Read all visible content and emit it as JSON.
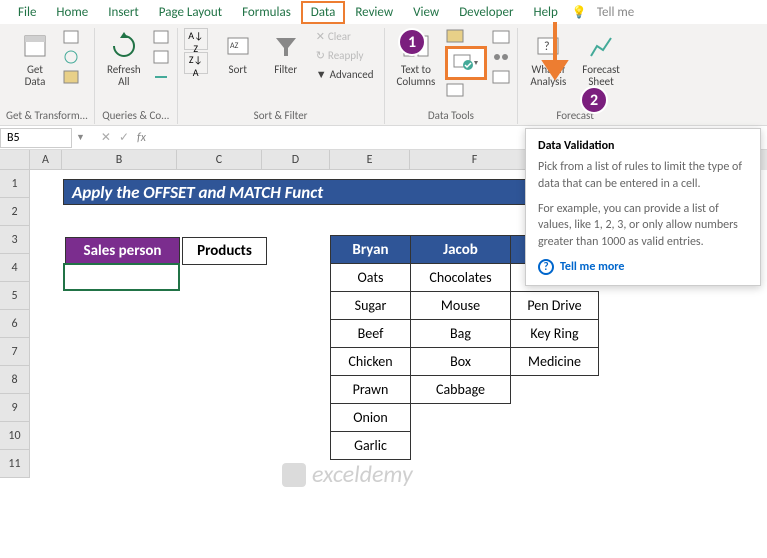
{
  "menu": {
    "items": [
      "File",
      "Home",
      "Insert",
      "Page Layout",
      "Formulas",
      "Data",
      "Review",
      "View",
      "Developer",
      "Help"
    ],
    "tellme": "Tell me"
  },
  "ribbon": {
    "getdata": "Get\nData",
    "refresh": "Refresh\nAll",
    "sort": "Sort",
    "filter": "Filter",
    "clear": "Clear",
    "reapply": "Reapply",
    "advanced": "Advanced",
    "t2c": "Text to\nColumns",
    "whatif": "What-If\nAnalysis",
    "forecast": "Forecast\nSheet",
    "groups": {
      "g1": "Get & Transform...",
      "g2": "Queries & Co...",
      "g3": "Sort & Filter",
      "g4": "Data Tools",
      "g5": "Forecast"
    }
  },
  "namebox": "B5",
  "tooltip": {
    "title": "Data Validation",
    "p1": "Pick from a list of rules to limit the type of data that can be entered in a cell.",
    "p2": "For example, you can provide a list of values, like 1, 2, 3, or only allow numbers greater than 1000 as valid entries.",
    "link": "Tell me more"
  },
  "title": "Apply the OFFSET and MATCH Funct",
  "tbl1": {
    "h1": "Sales person",
    "h2": "Products"
  },
  "tbl2": {
    "headers": [
      "Bryan",
      "Jacob",
      ""
    ],
    "rows": [
      [
        "Oats",
        "Chocolates",
        ""
      ],
      [
        "Sugar",
        "Mouse",
        "Pen Drive"
      ],
      [
        "Beef",
        "Bag",
        "Key Ring"
      ],
      [
        "Chicken",
        "Box",
        "Medicine"
      ],
      [
        "Prawn",
        "Cabbage",
        ""
      ],
      [
        "Onion",
        "",
        ""
      ],
      [
        "Garlic",
        "",
        ""
      ]
    ]
  },
  "cols": [
    "A",
    "B",
    "C",
    "D",
    "E",
    "F"
  ],
  "rows": [
    "1",
    "2",
    "3",
    "4",
    "5",
    "6",
    "7",
    "8",
    "9",
    "10",
    "11"
  ],
  "callouts": {
    "c1": "1",
    "c2": "2"
  },
  "watermark": "exceldemy"
}
